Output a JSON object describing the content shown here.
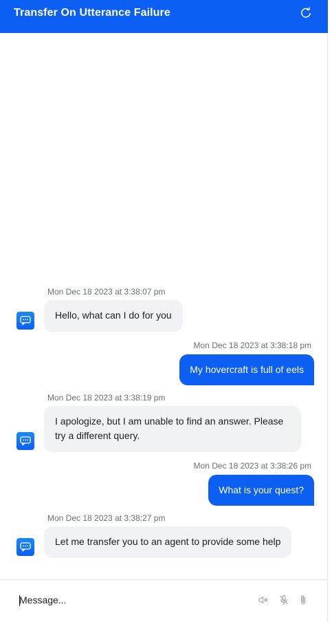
{
  "header": {
    "title": "Transfer On Utterance Failure",
    "refresh_icon": "refresh-icon"
  },
  "messages": [
    {
      "sender": "bot",
      "timestamp": "Mon Dec 18 2023 at 3:38:07 pm",
      "text": "Hello, what can I do for you"
    },
    {
      "sender": "user",
      "timestamp": "Mon Dec 18 2023 at 3:38:18 pm",
      "text": "My hovercraft is full of eels"
    },
    {
      "sender": "bot",
      "timestamp": "Mon Dec 18 2023 at 3:38:19 pm",
      "text": "I apologize, but I am unable to find an answer. Please try a different query."
    },
    {
      "sender": "user",
      "timestamp": "Mon Dec 18 2023 at 3:38:26 pm",
      "text": "What is your quest?"
    },
    {
      "sender": "bot",
      "timestamp": "Mon Dec 18 2023 at 3:38:27 pm",
      "text": "Let me transfer you to an agent to provide some help"
    }
  ],
  "composer": {
    "placeholder": "Message...",
    "value": "",
    "icons": [
      "speaker-mute-icon",
      "microphone-icon",
      "paperclip-icon"
    ]
  },
  "colors": {
    "accent": "#0b5ff2",
    "bot_bubble": "#f1f2f5",
    "timestamp_text": "#6b6f78"
  }
}
